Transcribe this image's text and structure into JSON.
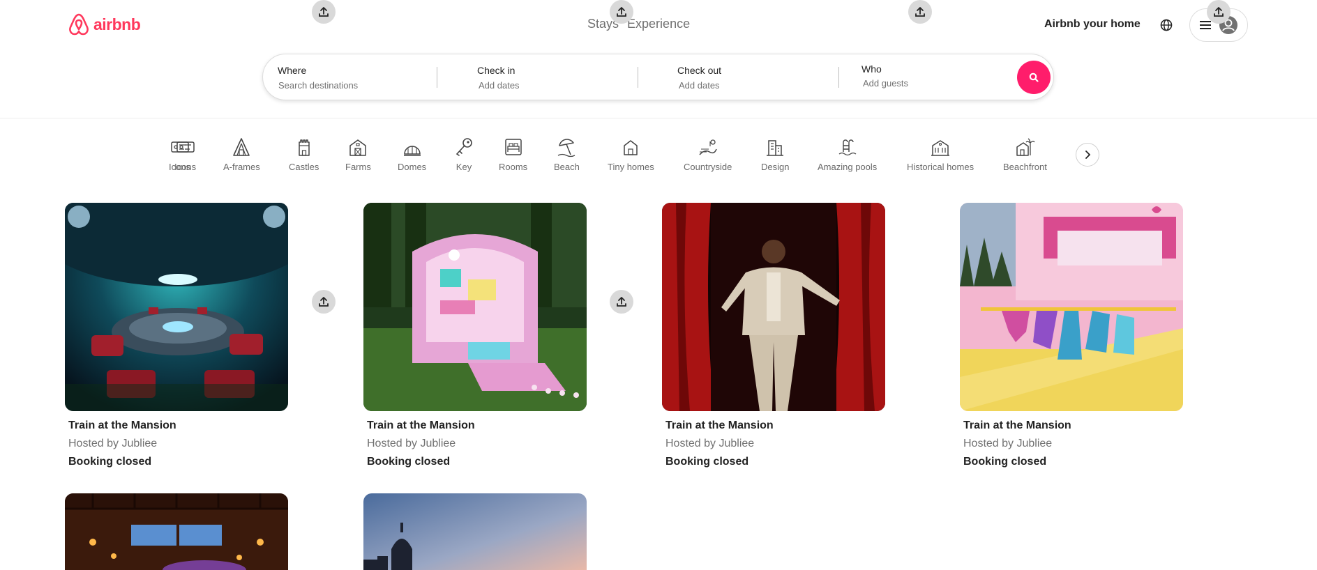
{
  "brand": {
    "name": "airbnb",
    "color": "#ff385c"
  },
  "header": {
    "tabs": [
      {
        "label": "Stays"
      },
      {
        "label": "Experience"
      }
    ],
    "host_link": "Airbnb your home",
    "icons": {
      "globe": "globe-icon",
      "menu": "hamburger-icon",
      "user": "user-avatar-icon",
      "upload": "upload-icon"
    }
  },
  "search": {
    "where": {
      "label": "Where",
      "placeholder": "Search destinations"
    },
    "checkin": {
      "label": "Check in",
      "placeholder": "Add dates"
    },
    "checkout": {
      "label": "Check out",
      "placeholder": "Add dates"
    },
    "who": {
      "label": "Who",
      "placeholder": "Add guests"
    },
    "button_icon": "search-icon",
    "button_color": "#ff1d6b"
  },
  "categories": [
    {
      "label": "Icons",
      "icon": "ticket-icon"
    },
    {
      "label": "A-frames",
      "icon": "a-frame-icon"
    },
    {
      "label": "Castles",
      "icon": "castle-icon"
    },
    {
      "label": "Farms",
      "icon": "farm-icon"
    },
    {
      "label": "Domes",
      "icon": "dome-icon"
    },
    {
      "label": "Key",
      "icon": "key-icon"
    },
    {
      "label": "Rooms",
      "icon": "room-icon"
    },
    {
      "label": "Beach",
      "icon": "beach-icon"
    },
    {
      "label": "Tiny homes",
      "icon": "tiny-home-icon"
    },
    {
      "label": "Countryside",
      "icon": "countryside-icon"
    },
    {
      "label": "Design",
      "icon": "design-icon"
    },
    {
      "label": "Amazing pools",
      "icon": "pool-icon"
    },
    {
      "label": "Historical homes",
      "icon": "historical-home-icon"
    },
    {
      "label": "Beachfront",
      "icon": "beachfront-icon"
    }
  ],
  "listings": [
    {
      "title": "Train at the Mansion",
      "host": "Hosted by Jubliee",
      "status": "Booking closed",
      "image": "spaceship-control-room"
    },
    {
      "title": "Train at the Mansion",
      "host": "Hosted by Jubliee",
      "status": "Booking closed",
      "image": "polly-pocket-compact-house"
    },
    {
      "title": "Train at the Mansion",
      "host": "Hosted by Jubliee",
      "status": "Booking closed",
      "image": "man-red-curtains"
    },
    {
      "title": "Train at the Mansion",
      "host": "Hosted by Jubliee",
      "status": "Booking closed",
      "image": "pink-dreamhouse-closet"
    },
    {
      "image": "wooden-cabin-interior"
    },
    {
      "image": "sunset-sky-silhouette"
    }
  ]
}
